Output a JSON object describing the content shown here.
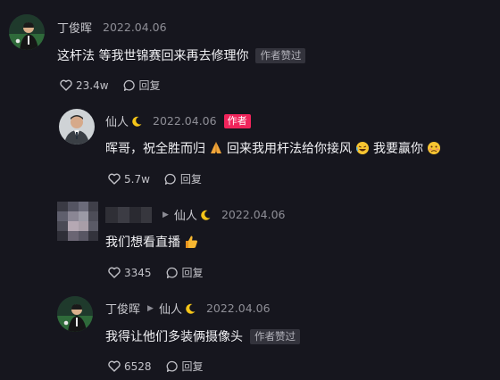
{
  "comments": [
    {
      "author": "丁俊晖",
      "date": "2022.04.06",
      "text": "这杆法 等我世锦赛回来再去修理你",
      "liked_tag": "作者赞过",
      "likes": "23.4w",
      "reply_label": "回复"
    },
    {
      "author": "仙人",
      "date": "2022.04.06",
      "author_tag": "作者",
      "text_parts": [
        "晖哥，祝全胜而归",
        "回来我用杆法给你接风",
        "我要赢你"
      ],
      "likes": "5.7w",
      "reply_label": "回复"
    },
    {
      "reply_to": "仙人",
      "date": "2022.04.06",
      "text": "我们想看直播",
      "likes": "3345",
      "reply_label": "回复"
    },
    {
      "author": "丁俊晖",
      "reply_to": "仙人",
      "date": "2022.04.06",
      "text": "我得让他们多装俩摄像头",
      "liked_tag": "作者赞过",
      "likes": "6528",
      "reply_label": "回复"
    }
  ],
  "icons": {
    "like": "heart-outline-icon",
    "reply": "speech-bubble-icon",
    "moon": "crescent-moon-icon",
    "arrow": "reply-arrow-icon"
  },
  "colors": {
    "background": "#16161e",
    "author_tag": "#f0245b",
    "liked_tag_bg": "#33333c"
  }
}
